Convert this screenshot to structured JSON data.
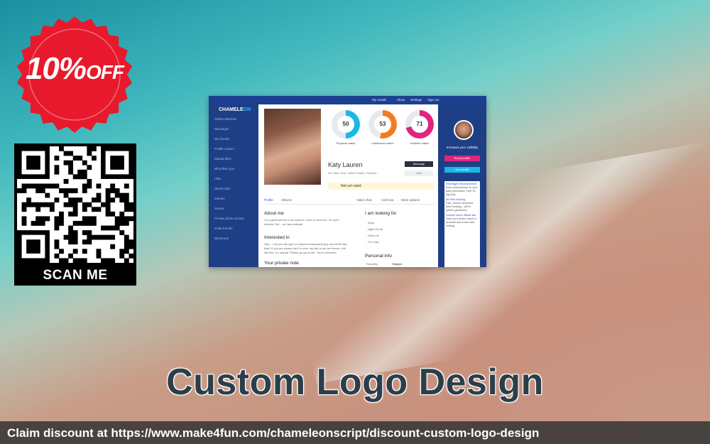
{
  "badge": {
    "percent": "10%",
    "off": "OFF",
    "color": "#e8192c"
  },
  "qr": {
    "label": "SCAN ME"
  },
  "title": "Custom Logo Design",
  "claim": {
    "text": "Claim discount at https://www.make4fun.com/chameleonscript/discount-custom-logo-design"
  },
  "screenshot": {
    "topnav": [
      "My emails",
      "Show",
      "Settings",
      "Sign out"
    ],
    "logo_a": "CHAMELE",
    "logo_b": "ON",
    "sidebar": [
      "Online Matches",
      "Messages",
      "My friends",
      "Profile visitors",
      "Mutual likes",
      "Who likes you",
      "I like",
      "Street chat",
      "Games",
      "Stores",
      "Private photo access",
      "Invite friends",
      "Backroom"
    ],
    "rings": [
      {
        "value": "50",
        "label": "Physical match",
        "color": "#1cb7e8"
      },
      {
        "value": "53",
        "label": "Intellectual match",
        "color": "#f47b20"
      },
      {
        "value": "71",
        "label": "Hobbies match",
        "color": "#e0257e"
      }
    ],
    "profile_name": "Katy Lauren",
    "profile_loc": "28 • New York, United States • Woman",
    "message_btn": "Message",
    "like_btn": "Like",
    "rated": "Not yet rated",
    "tabs": [
      "Profile",
      "Albums",
      "Video chat",
      "Call now",
      "More options"
    ],
    "about_h": "About me",
    "about_p": "I'm a great person to be around. I love to have fun, I'm open minded. But... an have attitude.",
    "interested_h": "Interested in",
    "interested_p": "Hey... I am you the type of easy/uncomplicated guy and stuff's like that? If you are please don't to ever my talk to me for friends, chit like this. I'm natural. Please go get to life. You're welcome.",
    "private_h": "Your private note",
    "looking_h": "I am looking for",
    "looking_items": [
      "- Boys",
      "- Aged 18-46",
      "- Near me",
      "- For chat"
    ],
    "personal_h": "Personal info",
    "personal_row": [
      "Sexuality",
      "Straight"
    ],
    "right": {
      "visibility": "Increase your visibility",
      "boost": "Boost profile",
      "get": "Get credits",
      "ads": [
        {
          "title": "VitoriNight Wholesomeoff",
          "text": "Earn commissions on your daily purchases. Free 30 day trial."
        },
        {
          "title": "All-Web Hosting",
          "text": "Fast, Secure Unlimited Web Hosting - 100% uptime guarantee."
        },
        {
          "title": "Domain name official site",
          "text": "Grab your dream name in seconds and a free web hosting."
        }
      ]
    }
  }
}
